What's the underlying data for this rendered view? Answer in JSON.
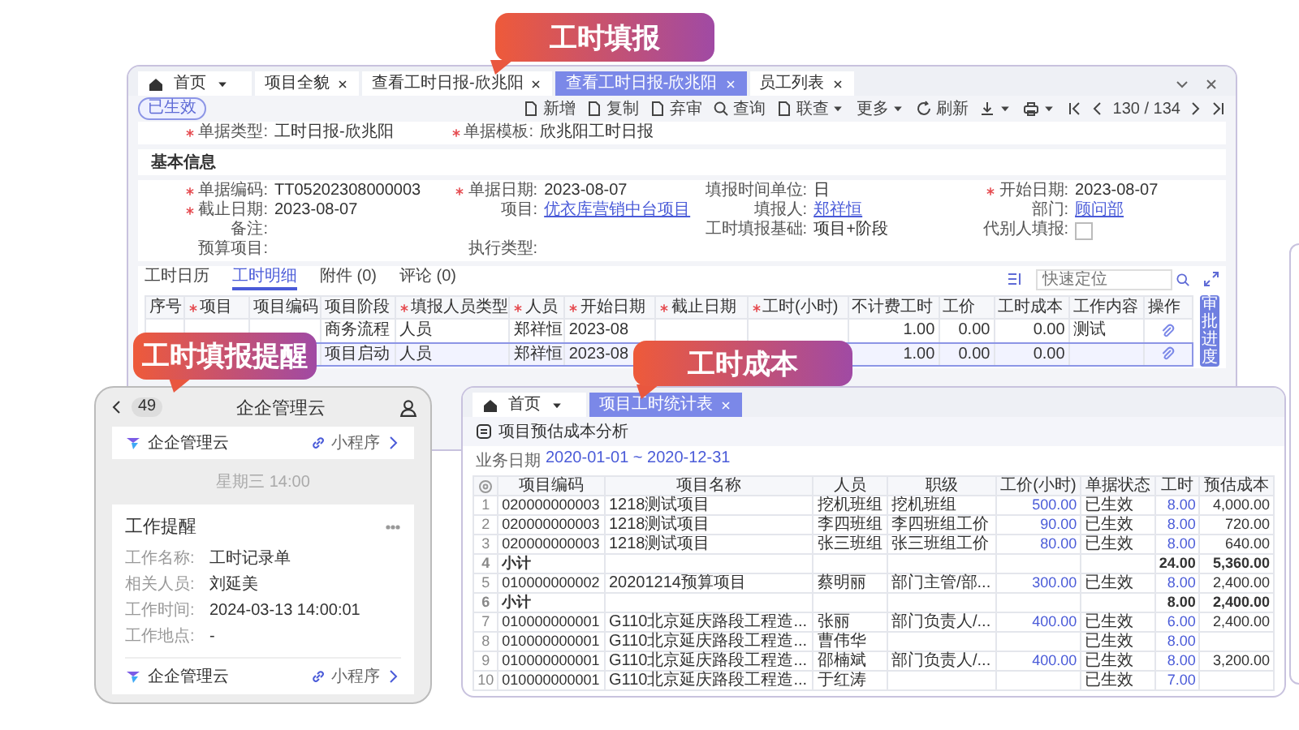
{
  "main_window": {
    "callout": "工时填报",
    "tabs": [
      {
        "label": "首页",
        "kind": "home",
        "selected": false
      },
      {
        "label": "项目全貌",
        "kind": "page",
        "selected": false
      },
      {
        "label": "查看工时日报-欣兆阳",
        "kind": "page",
        "selected": false
      },
      {
        "label": "查看工时日报-欣兆阳",
        "kind": "page",
        "selected": true
      },
      {
        "label": "员工列表",
        "kind": "page",
        "selected": false
      }
    ],
    "status_badge": "已生效",
    "toolbar": [
      {
        "label": "新增",
        "kind": "new",
        "dropdown": false
      },
      {
        "label": "复制",
        "kind": "copy",
        "dropdown": false
      },
      {
        "label": "弃审",
        "kind": "unaudit",
        "dropdown": false
      },
      {
        "label": "查询",
        "kind": "search",
        "dropdown": false
      },
      {
        "label": "联查",
        "kind": "linked",
        "dropdown": true
      },
      {
        "label": "更多",
        "kind": "more",
        "dropdown": true
      },
      {
        "label": "刷新",
        "kind": "refresh",
        "dropdown": false
      },
      {
        "kind": "download",
        "dropdown": true
      },
      {
        "kind": "print",
        "dropdown": true
      }
    ],
    "pager": "130 / 134",
    "header_fields": [
      {
        "label": "单据类型:",
        "required": true,
        "kind": "text",
        "value": "工时日报-欣兆阳"
      },
      {
        "label": "单据模板:",
        "required": true,
        "kind": "text",
        "value": "欣兆阳工时日报"
      }
    ],
    "section_title": "基本信息",
    "field_rows": [
      [
        {
          "label": "单据编码:",
          "required": true,
          "kind": "text",
          "value": "TT05202308000003"
        },
        {
          "label": "单据日期:",
          "required": true,
          "kind": "text",
          "value": "2023-08-07"
        },
        {
          "label": "填报时间单位:",
          "required": false,
          "kind": "text",
          "value": "日"
        },
        {
          "label": "开始日期:",
          "required": true,
          "kind": "text",
          "value": "2023-08-07"
        }
      ],
      [
        {
          "label": "截止日期:",
          "required": true,
          "kind": "text",
          "value": "2023-08-07"
        },
        {
          "label": "项目:",
          "required": false,
          "kind": "link",
          "value": "优衣库营销中台项目"
        },
        {
          "label": "填报人:",
          "required": false,
          "kind": "link",
          "value": "郑祥恒"
        },
        {
          "label": "部门:",
          "required": false,
          "kind": "link",
          "value": "顾问部"
        }
      ],
      [
        {
          "label": "备注:",
          "required": false,
          "kind": "text"
        },
        null,
        {
          "label": "工时填报基础:",
          "required": false,
          "kind": "text",
          "value": "项目+阶段"
        },
        {
          "label": "代别人填报:",
          "required": false,
          "kind": "checkbox",
          "checked": false
        }
      ],
      [
        {
          "label": "预算项目:",
          "required": false,
          "kind": "text"
        },
        {
          "label": "执行类型:",
          "required": false,
          "kind": "text"
        }
      ]
    ],
    "detail_tabs": [
      {
        "label": "工时日历",
        "selected": false
      },
      {
        "label": "工时明细",
        "selected": true
      },
      {
        "label": "附件 (0)",
        "selected": false
      },
      {
        "label": "评论 (0)",
        "selected": false
      }
    ],
    "quick_search": {
      "placeholder": "快速定位"
    },
    "table": {
      "columns": [
        {
          "label": "序号",
          "required": false,
          "kind": "text"
        },
        {
          "label": "项目",
          "required": true,
          "kind": "text"
        },
        {
          "label": "项目编码",
          "required": false,
          "kind": "text"
        },
        {
          "label": "项目阶段",
          "required": false,
          "kind": "text"
        },
        {
          "label": "填报人员类型",
          "required": true,
          "kind": "text"
        },
        {
          "label": "人员",
          "required": true,
          "kind": "text"
        },
        {
          "label": "开始日期",
          "required": true,
          "kind": "text"
        },
        {
          "label": "截止日期",
          "required": true,
          "kind": "text"
        },
        {
          "label": "工时(小时)",
          "required": true,
          "kind": "number"
        },
        {
          "label": "不计费工时",
          "required": false,
          "kind": "number"
        },
        {
          "label": "工价",
          "required": false,
          "kind": "number"
        },
        {
          "label": "工时成本",
          "required": false,
          "kind": "number"
        },
        {
          "label": "工作内容",
          "required": false,
          "kind": "text"
        },
        {
          "label": "操作",
          "required": false,
          "kind": "action"
        }
      ],
      "rows": [
        {
          "selected": false,
          "cells": [
            null,
            null,
            null,
            "商务流程",
            "人员",
            "郑祥恒",
            "2023-08",
            null,
            null,
            "1.00",
            "0.00",
            "0.00",
            "测试",
            null
          ]
        },
        {
          "selected": true,
          "cells": [
            null,
            null,
            null,
            "项目启动",
            "人员",
            "郑祥恒",
            "2023-08",
            null,
            null,
            "1.00",
            "0.00",
            "0.00",
            null,
            null
          ]
        }
      ]
    },
    "side_tab": "审批进度"
  },
  "reminder_phone": {
    "callout": "工时填报提醒",
    "back_count": "49",
    "title": "企企管理云",
    "top_card": {
      "app": "企企管理云",
      "link": "小程序"
    },
    "time": "星期三 14:00",
    "card": {
      "title": "工作提醒",
      "fields": [
        {
          "label": "工作名称:",
          "value": "工时记录单"
        },
        {
          "label": "相关人员:",
          "value": "刘延美"
        },
        {
          "label": "工作时间:",
          "value": "2024-03-13 14:00:01"
        },
        {
          "label": "工作地点:",
          "value": "-"
        }
      ],
      "footer": {
        "app": "企企管理云",
        "link": "小程序"
      }
    }
  },
  "cost_window": {
    "callout": "工时成本",
    "tabs": [
      {
        "label": "首页",
        "kind": "home",
        "selected": false
      },
      {
        "label": "项目工时统计表",
        "kind": "page",
        "selected": true
      }
    ],
    "title": "项目预估成本分析",
    "date_label": "业务日期",
    "date_range": "2020-01-01 ~ 2020-12-31",
    "table": {
      "columns": [
        {
          "kind": "index"
        },
        {
          "label": "项目编码",
          "kind": "code"
        },
        {
          "label": "项目名称",
          "kind": "text"
        },
        {
          "label": "人员",
          "kind": "text"
        },
        {
          "label": "职级",
          "kind": "text"
        },
        {
          "label": "工价(小时)",
          "kind": "link"
        },
        {
          "label": "单据状态",
          "kind": "text"
        },
        {
          "label": "工时",
          "kind": "link"
        },
        {
          "label": "预估成本",
          "kind": "number"
        }
      ],
      "rows": [
        {
          "kind": "item",
          "cells": [
            "1",
            "020000000003",
            "1218测试项目",
            "挖机班组",
            "挖机班组",
            "500.00",
            "已生效",
            "8.00",
            "4,000.00"
          ]
        },
        {
          "kind": "item",
          "cells": [
            "2",
            "020000000003",
            "1218测试项目",
            "李四班组",
            "李四班组工价",
            "90.00",
            "已生效",
            "8.00",
            "720.00"
          ]
        },
        {
          "kind": "item",
          "cells": [
            "3",
            "020000000003",
            "1218测试项目",
            "张三班组",
            "张三班组工价",
            "80.00",
            "已生效",
            "8.00",
            "640.00"
          ]
        },
        {
          "kind": "subtotal",
          "cells": [
            "4",
            "小计",
            null,
            null,
            null,
            null,
            null,
            "24.00",
            "5,360.00"
          ]
        },
        {
          "kind": "item",
          "cells": [
            "5",
            "010000000002",
            "20201214预算项目",
            "蔡明丽",
            "部门主管/部...",
            "300.00",
            "已生效",
            "8.00",
            "2,400.00"
          ]
        },
        {
          "kind": "subtotal",
          "cells": [
            "6",
            "小计",
            null,
            null,
            null,
            null,
            null,
            "8.00",
            "2,400.00"
          ]
        },
        {
          "kind": "item",
          "cells": [
            "7",
            "010000000001",
            "G110北京延庆路段工程造...",
            "张丽",
            "部门负责人/...",
            "400.00",
            "已生效",
            "6.00",
            "2,400.00"
          ]
        },
        {
          "kind": "item",
          "cells": [
            "8",
            "010000000001",
            "G110北京延庆路段工程造...",
            "曹伟华",
            null,
            null,
            "已生效",
            "8.00",
            null
          ]
        },
        {
          "kind": "item",
          "cells": [
            "9",
            "010000000001",
            "G110北京延庆路段工程造...",
            "邵楠斌",
            "部门负责人/...",
            "400.00",
            "已生效",
            "8.00",
            "3,200.00"
          ]
        },
        {
          "kind": "item",
          "cells": [
            "10",
            "010000000001",
            "G110北京延庆路段工程造...",
            "于红涛",
            null,
            null,
            "已生效",
            "7.00",
            null
          ]
        }
      ]
    }
  }
}
